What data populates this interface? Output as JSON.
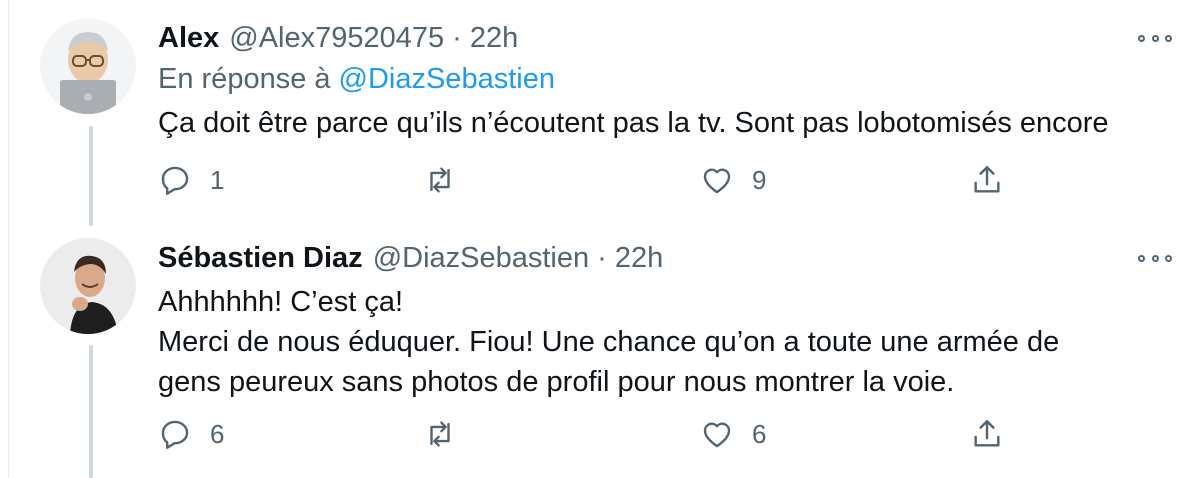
{
  "tweets": [
    {
      "name": "Alex",
      "handle": "@Alex79520475",
      "separator": "·",
      "time": "22h",
      "reply_prefix": "En réponse à",
      "reply_mention": "@DiazSebastien",
      "lines": [
        "Ça doit être parce qu’ils n’écoutent pas la tv. Sont pas lobotomisés encore"
      ],
      "replies": "1",
      "retweets": "",
      "likes": "9",
      "avatar_icon": "memoji-laptop-avatar",
      "colors": {
        "accent": "#1d9bf0",
        "muted": "#536471"
      }
    },
    {
      "name": "Sébastien Diaz",
      "handle": "@DiazSebastien",
      "separator": "·",
      "time": "22h",
      "lines": [
        "Ahhhhhh! C’est ça!",
        "Merci de nous éduquer. Fiou! Une chance qu’on a toute une armée de",
        "gens peureux sans photos de profil pour nous montrer la voie."
      ],
      "replies": "6",
      "retweets": "",
      "likes": "6",
      "avatar_icon": "profile-photo-avatar"
    }
  ],
  "icons": [
    "reply-icon",
    "retweet-icon",
    "like-icon",
    "share-icon",
    "more-options-icon"
  ]
}
